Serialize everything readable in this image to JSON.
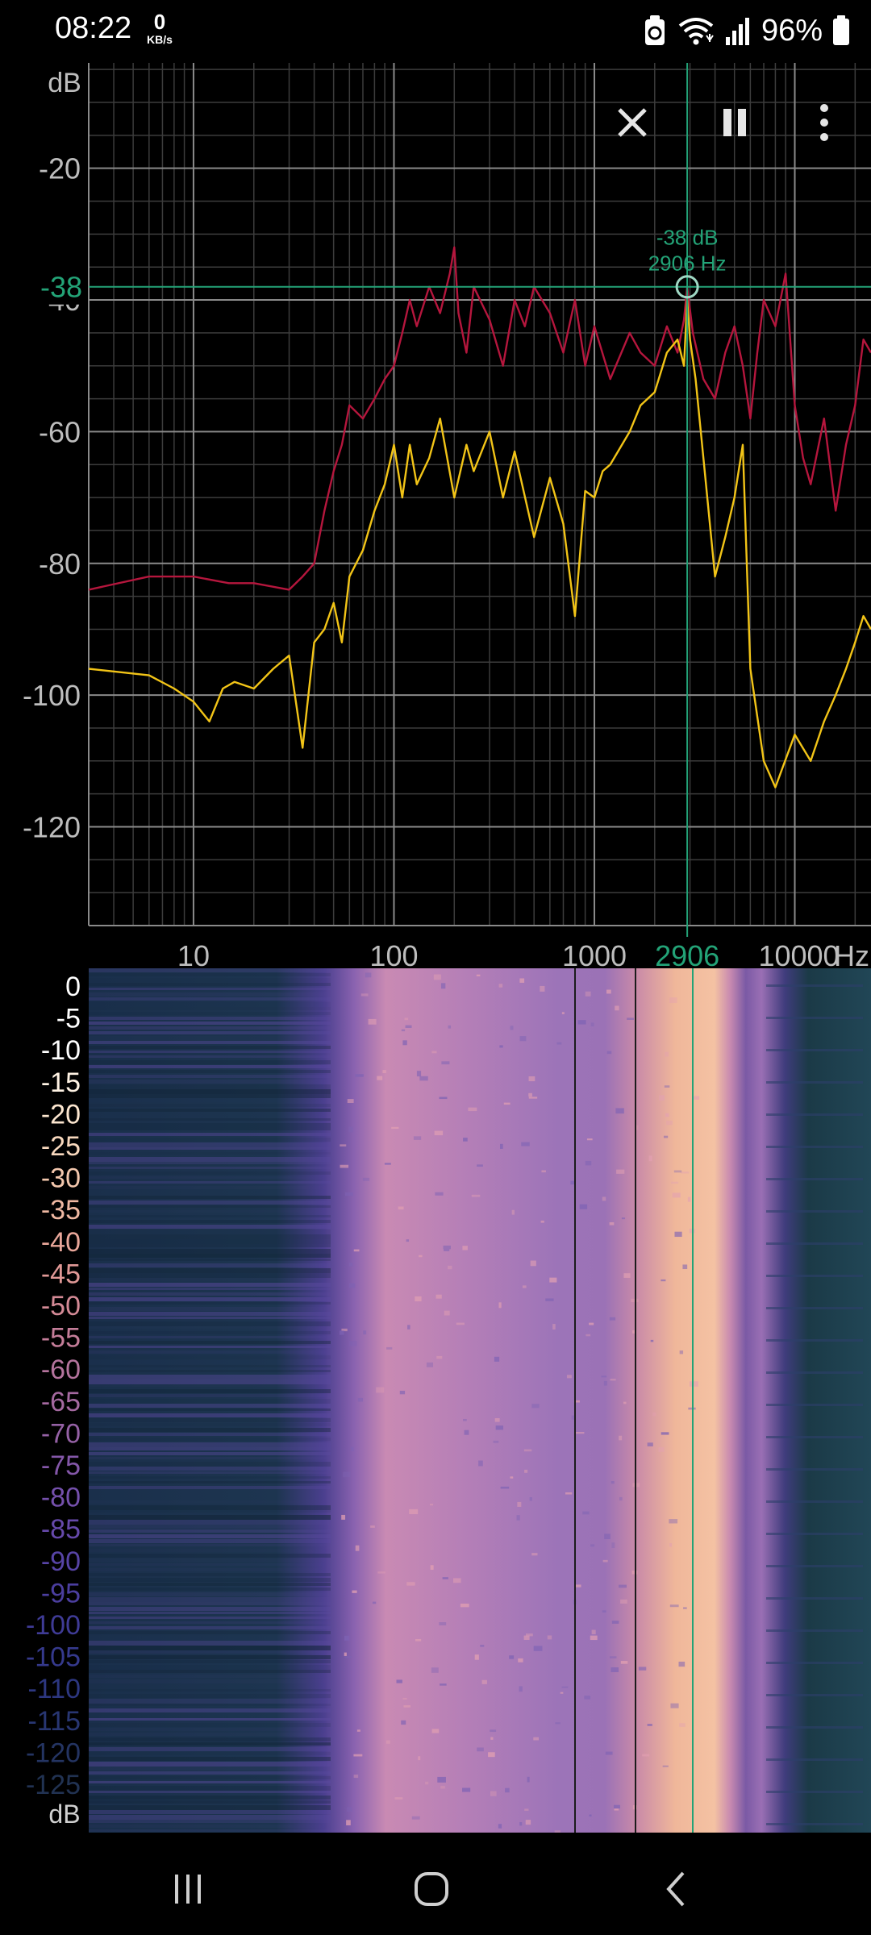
{
  "status_bar": {
    "time": "08:22",
    "net_speed_value": "0",
    "net_speed_unit": "KB/s",
    "battery_percent": "96%",
    "icons": [
      "recycle-icon",
      "wifi-icon",
      "signal-icon",
      "battery-icon"
    ]
  },
  "controls": {
    "close_icon": "close-icon",
    "pause_icon": "pause-icon",
    "menu_icon": "more-vert-icon"
  },
  "spectrum": {
    "y_unit": "dB",
    "y_ticks": [
      "-20",
      "-40",
      "-60",
      "-80",
      "-100",
      "-120"
    ],
    "x_ticks": [
      "10",
      "100",
      "1000",
      "10000"
    ],
    "x_unit": "Hz",
    "cursor_db_label": "-38",
    "cursor_freq_axis_label": "2906",
    "cursor_readout_db": "-38 dB",
    "cursor_readout_hz": "2906 Hz",
    "colors": {
      "peak": "#b5163d",
      "current": "#f2c417",
      "cursor": "#23a377",
      "grid": "#5a5a5a"
    }
  },
  "chart_data": {
    "type": "line",
    "x_scale": "log",
    "xlim": [
      3,
      24000
    ],
    "ylim": [
      -135,
      -4
    ],
    "xlabel": "Hz",
    "ylabel": "dB",
    "series": [
      {
        "color": "#b5163d",
        "x": [
          3,
          6,
          10,
          15,
          20,
          30,
          35,
          40,
          45,
          50,
          55,
          60,
          70,
          80,
          90,
          100,
          110,
          120,
          130,
          150,
          170,
          190,
          200,
          210,
          230,
          250,
          300,
          350,
          400,
          450,
          500,
          600,
          700,
          800,
          900,
          1000,
          1200,
          1500,
          1700,
          2000,
          2300,
          2600,
          2800,
          2906,
          3100,
          3500,
          4000,
          4500,
          5000,
          5500,
          6000,
          6500,
          7000,
          8000,
          9000,
          10000,
          11000,
          12000,
          14000,
          16000,
          18000,
          20000,
          22000,
          24000
        ],
        "y": [
          -84,
          -82,
          -82,
          -83,
          -83,
          -84,
          -82,
          -80,
          -72,
          -66,
          -62,
          -56,
          -58,
          -55,
          -52,
          -50,
          -45,
          -40,
          -44,
          -38,
          -42,
          -36,
          -32,
          -42,
          -48,
          -38,
          -43,
          -50,
          -40,
          -44,
          -38,
          -42,
          -48,
          -40,
          -50,
          -44,
          -52,
          -45,
          -48,
          -50,
          -44,
          -48,
          -43,
          -38,
          -45,
          -52,
          -55,
          -48,
          -44,
          -50,
          -58,
          -48,
          -40,
          -44,
          -36,
          -56,
          -64,
          -68,
          -58,
          -72,
          -62,
          -56,
          -46,
          -48
        ]
      },
      {
        "color": "#f2c417",
        "x": [
          3,
          6,
          8,
          10,
          12,
          14,
          16,
          20,
          25,
          30,
          35,
          40,
          45,
          50,
          55,
          60,
          70,
          80,
          90,
          100,
          110,
          120,
          130,
          150,
          170,
          200,
          230,
          250,
          300,
          350,
          400,
          500,
          600,
          700,
          800,
          900,
          1000,
          1100,
          1200,
          1500,
          1700,
          2000,
          2300,
          2600,
          2800,
          2906,
          3000,
          3200,
          3500,
          4000,
          4500,
          5000,
          5500,
          6000,
          7000,
          8000,
          10000,
          12000,
          14000,
          16000,
          18000,
          20000,
          22000,
          24000
        ],
        "y": [
          -96,
          -97,
          -99,
          -101,
          -104,
          -99,
          -98,
          -99,
          -96,
          -94,
          -108,
          -92,
          -90,
          -86,
          -92,
          -82,
          -78,
          -72,
          -68,
          -62,
          -70,
          -62,
          -68,
          -64,
          -58,
          -70,
          -62,
          -66,
          -60,
          -70,
          -63,
          -76,
          -67,
          -74,
          -88,
          -69,
          -70,
          -66,
          -65,
          -60,
          -56,
          -54,
          -48,
          -46,
          -50,
          -40,
          -46,
          -52,
          -64,
          -82,
          -76,
          -70,
          -62,
          -96,
          -110,
          -114,
          -106,
          -110,
          -104,
          -100,
          -96,
          -92,
          -88,
          -90
        ]
      }
    ]
  },
  "spectrogram": {
    "time_ticks": [
      "0",
      "-5",
      "-10",
      "-15",
      "-20",
      "-25",
      "-30",
      "-35",
      "-40",
      "-45",
      "-50",
      "-55",
      "-60",
      "-65",
      "-70",
      "-75",
      "-80",
      "-85",
      "-90",
      "-95",
      "-100",
      "-105",
      "-110",
      "-115",
      "-120",
      "-125"
    ],
    "y_unit": "dB"
  },
  "nav_bar": {
    "recents_icon": "recents-icon",
    "home_icon": "home-icon",
    "back_icon": "back-icon"
  }
}
